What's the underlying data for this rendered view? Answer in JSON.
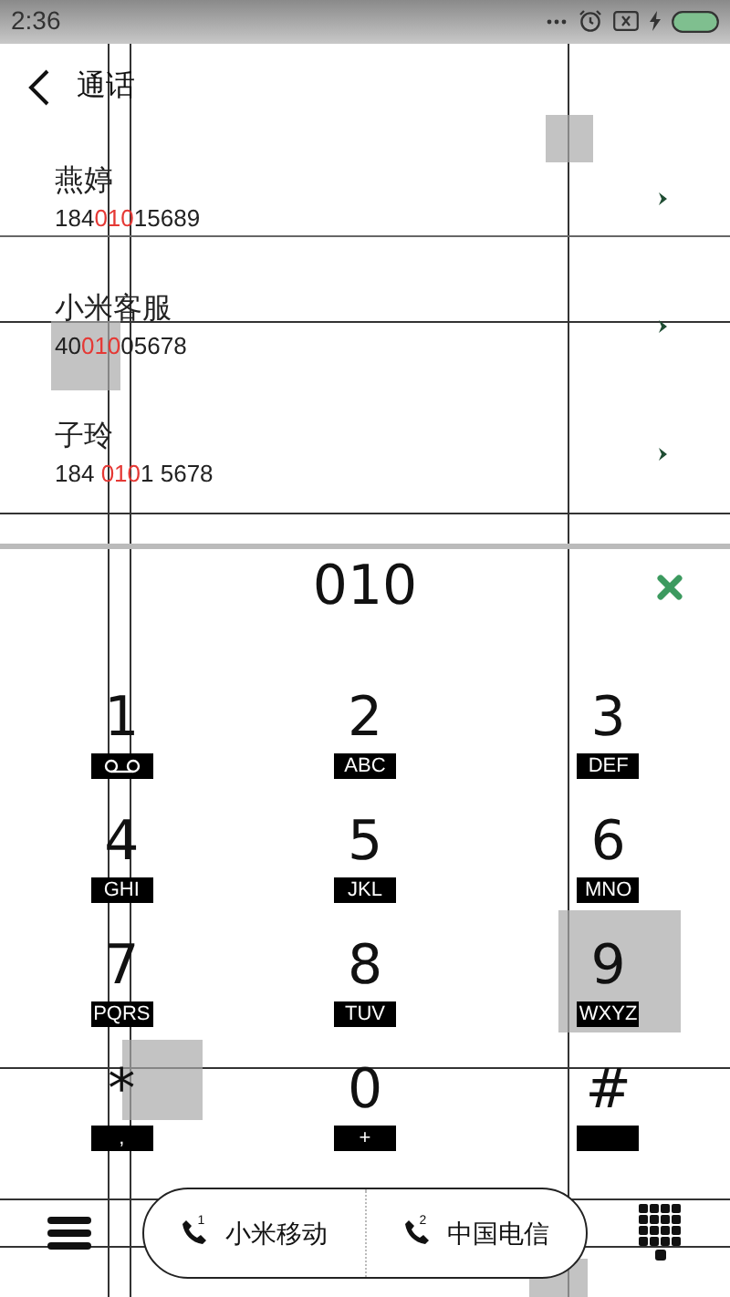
{
  "status_bar": {
    "time": "2:36"
  },
  "header": {
    "title": "通话"
  },
  "contacts": [
    {
      "name": "燕婷",
      "number_before": "184",
      "number_match": "010",
      "number_after": "15689"
    },
    {
      "name": "小米客服",
      "number_before": "40",
      "number_match": "010",
      "number_after": "05678"
    },
    {
      "name": "子玲",
      "number_before": "184 ",
      "number_match": "010",
      "number_after": "1 5678"
    }
  ],
  "dialed_number": "010",
  "keys": [
    {
      "digit": "1",
      "kind": "voicemail"
    },
    {
      "digit": "2",
      "kind": "letters",
      "letters": "ABC"
    },
    {
      "digit": "3",
      "kind": "letters",
      "letters": "DEF"
    },
    {
      "digit": "4",
      "kind": "letters",
      "letters": "GHI"
    },
    {
      "digit": "5",
      "kind": "letters",
      "letters": "JKL"
    },
    {
      "digit": "6",
      "kind": "letters",
      "letters": "MNO"
    },
    {
      "digit": "7",
      "kind": "letters",
      "letters": "PQRS"
    },
    {
      "digit": "8",
      "kind": "letters",
      "letters": "TUV"
    },
    {
      "digit": "9",
      "kind": "letters",
      "letters": "WXYZ"
    },
    {
      "digit": "*",
      "kind": "letters",
      "letters": ","
    },
    {
      "digit": "0",
      "kind": "letters",
      "letters": "+"
    },
    {
      "digit": "#",
      "kind": "blank"
    }
  ],
  "sim_buttons": [
    {
      "slot": "1",
      "label": "小米移动"
    },
    {
      "slot": "2",
      "label": "中国电信"
    }
  ]
}
